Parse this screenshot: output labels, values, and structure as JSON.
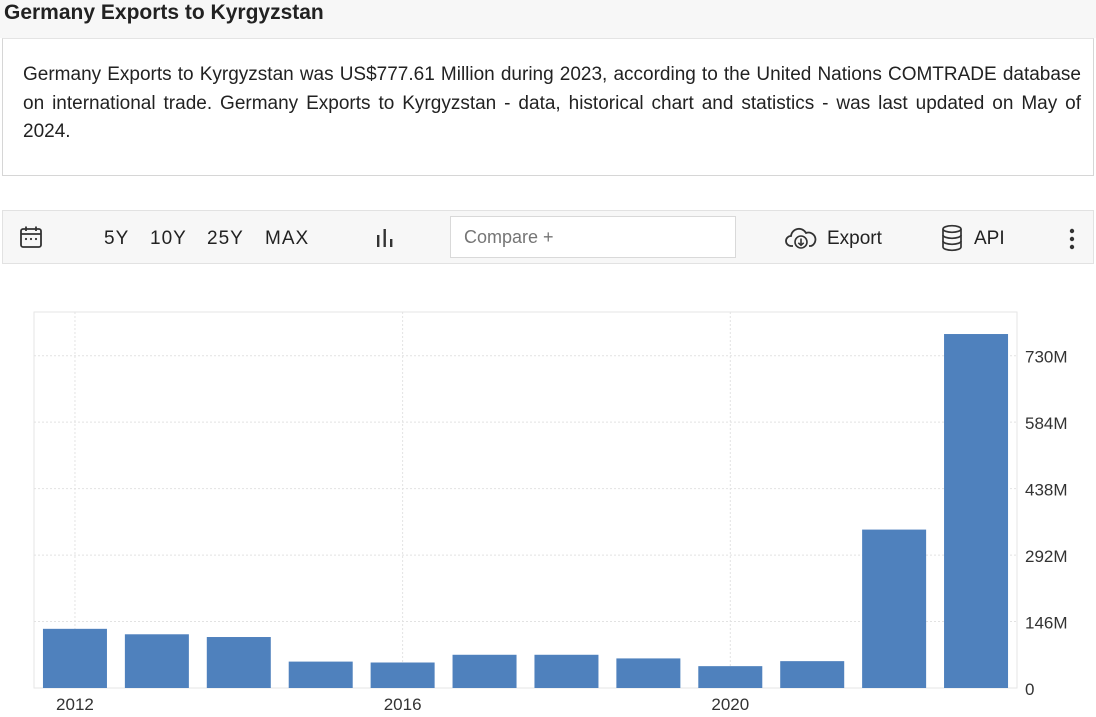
{
  "header": {
    "title": "Germany Exports to Kyrgyzstan"
  },
  "description": "Germany Exports to Kyrgyzstan was US$777.61 Million during 2023, according to the United Nations COMTRADE database on international trade. Germany Exports to Kyrgyzstan - data, historical chart and statistics - was last updated on May of 2024.",
  "toolbar": {
    "calendar_icon": "calendar-icon",
    "ranges": [
      "5Y",
      "10Y",
      "25Y",
      "MAX"
    ],
    "chart_type_icon": "bar-chart-icon",
    "compare_placeholder": "Compare +",
    "export_label": "Export",
    "export_icon": "cloud-download-icon",
    "api_label": "API",
    "api_icon": "database-icon",
    "more_icon": "kebab-menu-icon"
  },
  "chart_data": {
    "type": "bar",
    "categories": [
      "2012",
      "2013",
      "2014",
      "2015",
      "2016",
      "2017",
      "2018",
      "2019",
      "2020",
      "2021",
      "2022",
      "2023"
    ],
    "values": [
      130,
      118,
      112,
      58,
      56,
      73,
      73,
      65,
      48,
      59,
      348,
      777.61
    ],
    "x_tick_labels": [
      "2012",
      "2016",
      "2020"
    ],
    "y_tick_labels": [
      "0",
      "146M",
      "292M",
      "438M",
      "584M",
      "730M"
    ],
    "y_ticks": [
      0,
      146,
      292,
      438,
      584,
      730
    ],
    "ylim": [
      0,
      826
    ],
    "unit": "Million US$",
    "color": "#4f81bd",
    "grid": true
  }
}
